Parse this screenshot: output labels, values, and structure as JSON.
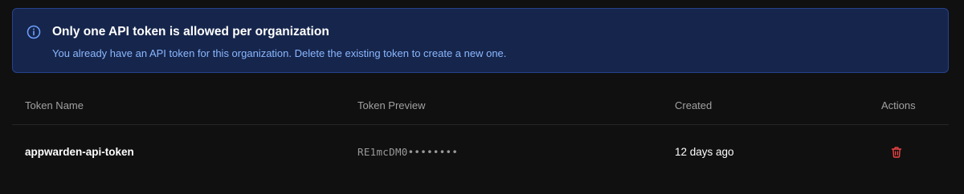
{
  "alert": {
    "icon": "info-icon",
    "title": "Only one API token is allowed per organization",
    "description": "You already have an API token for this organization. Delete the existing token to create a new one."
  },
  "table": {
    "headers": {
      "name": "Token Name",
      "preview": "Token Preview",
      "created": "Created",
      "actions": "Actions"
    },
    "rows": [
      {
        "name": "appwarden-api-token",
        "preview": "RE1mcDM0••••••••",
        "created": "12 days ago",
        "action_icon": "trash-icon"
      }
    ]
  },
  "colors": {
    "background": "#101010",
    "alert_background": "#16254c",
    "alert_border": "#26428a",
    "alert_text": "#8ab8ff",
    "danger": "#ef4444"
  }
}
